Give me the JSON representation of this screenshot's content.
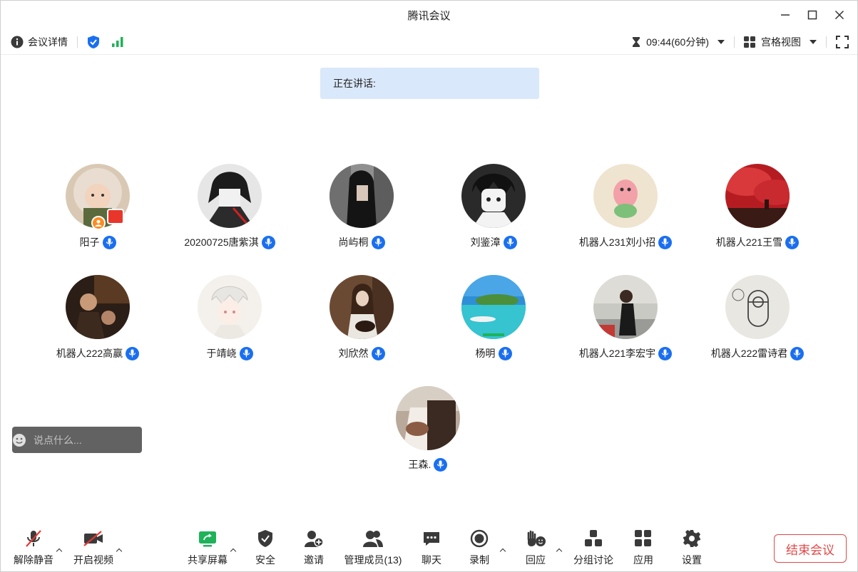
{
  "window": {
    "title": "腾讯会议"
  },
  "infobar": {
    "meeting_details": "会议详情",
    "timer": "09:44(60分钟)",
    "view_mode": "宫格视图"
  },
  "speaking": {
    "label": "正在讲话:"
  },
  "participants": [
    {
      "name": "阳子"
    },
    {
      "name": "20200725唐紫淇"
    },
    {
      "name": "尚屿桐"
    },
    {
      "name": "刘鉴漳"
    },
    {
      "name": "机器人231刘小招"
    },
    {
      "name": "机器人221王雪"
    },
    {
      "name": "机器人222高赢"
    },
    {
      "name": "于靖峣"
    },
    {
      "name": "刘欣然"
    },
    {
      "name": "杨明"
    },
    {
      "name": "机器人221李宏宇"
    },
    {
      "name": "机器人222雷诗君"
    },
    {
      "name": "王森."
    }
  ],
  "chat": {
    "placeholder": "说点什么..."
  },
  "toolbar": {
    "unmute": "解除静音",
    "start_video": "开启视频",
    "share_screen": "共享屏幕",
    "security": "安全",
    "invite": "邀请",
    "manage_members": "管理成员(13)",
    "chat": "聊天",
    "record": "录制",
    "reactions": "回应",
    "breakout": "分组讨论",
    "apps": "应用",
    "settings": "设置",
    "end_meeting": "结束会议"
  },
  "colors": {
    "accent_blue": "#1a6ff0",
    "signal_green": "#1fb25a",
    "end_red": "#e04848",
    "speaking_bg": "#dae8fb"
  }
}
